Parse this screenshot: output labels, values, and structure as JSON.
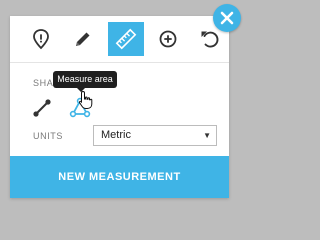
{
  "toolbar": {
    "tools": [
      {
        "icon": "location-pin-icon"
      },
      {
        "icon": "pencil-icon"
      },
      {
        "icon": "ruler-icon",
        "active": true
      },
      {
        "icon": "add-circle-icon"
      },
      {
        "icon": "undo-icon"
      }
    ]
  },
  "shape": {
    "label": "SHAPE",
    "tooltip": "Measure area",
    "options": [
      {
        "icon": "line-measure-icon"
      },
      {
        "icon": "area-measure-icon",
        "hovered": true
      }
    ]
  },
  "units": {
    "label": "UNITS",
    "selected": "Metric"
  },
  "new_measurement_label": "NEW MEASUREMENT",
  "colors": {
    "accent": "#3fb4e6",
    "tooltip_bg": "#1f1f1f",
    "background": "#bdbdbd"
  }
}
